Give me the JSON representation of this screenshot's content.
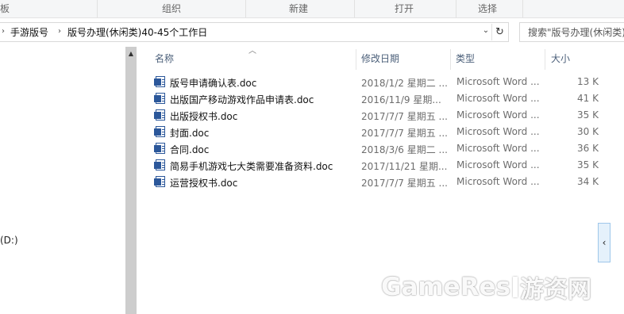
{
  "ribbon": {
    "groups": [
      "板",
      "组织",
      "新建",
      "打开",
      "选择"
    ]
  },
  "address": {
    "crumbs": [
      "手游版号",
      "版号办理(休闲类)40-45个工作日"
    ],
    "refresh_icon": "refresh-icon",
    "dropdown_icon": "chevron-down-icon"
  },
  "search": {
    "placeholder": "搜索\"版号办理(休闲类)"
  },
  "nav": {
    "drive_label": "(D:)"
  },
  "columns": {
    "name": "名称",
    "date": "修改日期",
    "type": "类型",
    "size": "大小",
    "sorted_by": "name"
  },
  "files": [
    {
      "name": "版号申请确认表.doc",
      "date": "2018/1/2 星期二 ...",
      "type": "Microsoft Word ...",
      "size": "13 K"
    },
    {
      "name": "出版国产移动游戏作品申请表.doc",
      "date": "2016/11/9 星期...",
      "type": "Microsoft Word ...",
      "size": "41 K"
    },
    {
      "name": "出版授权书.doc",
      "date": "2017/7/7 星期五 ...",
      "type": "Microsoft Word ...",
      "size": "35 K"
    },
    {
      "name": "封面.doc",
      "date": "2017/7/7 星期五 ...",
      "type": "Microsoft Word ...",
      "size": "30 K"
    },
    {
      "name": "合同.doc",
      "date": "2018/3/6 星期二 ...",
      "type": "Microsoft Word ...",
      "size": "36 K"
    },
    {
      "name": "简易手机游戏七大类需要准备资料.doc",
      "date": "2017/11/21 星期...",
      "type": "Microsoft Word ...",
      "size": "35 K"
    },
    {
      "name": "运营授权书.doc",
      "date": "2017/7/7 星期五 ...",
      "type": "Microsoft Word ...",
      "size": "34 K"
    }
  ],
  "watermark": {
    "en": "GameRes",
    "cn": "游资网"
  },
  "colors": {
    "word_icon": "#2b579a",
    "header_text": "#4c607a",
    "preview_toggle": "#e5f1fb"
  }
}
